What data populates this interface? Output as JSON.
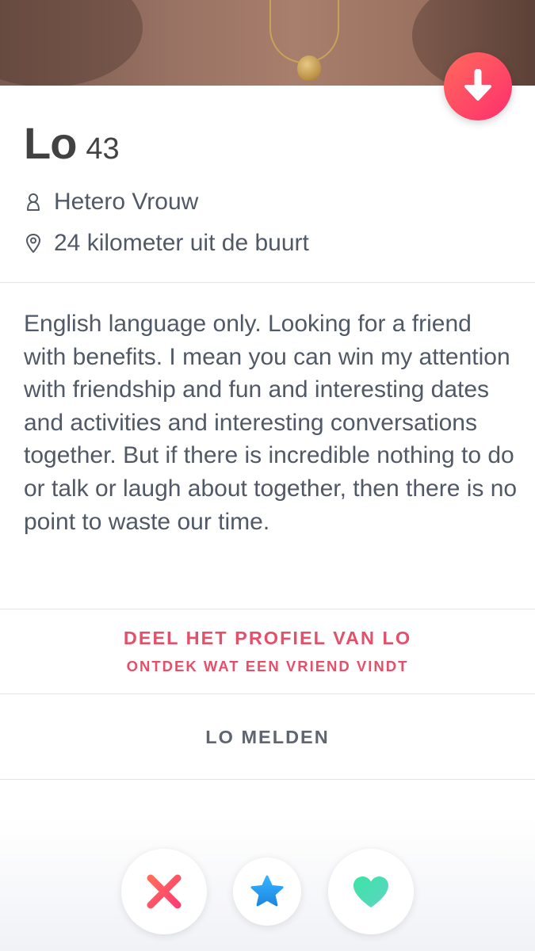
{
  "profile": {
    "name": "Lo",
    "age": "43",
    "orientation": "Hetero Vrouw",
    "distance": "24 kilometer uit de buurt",
    "bio": "English language only. Looking for a friend with benefits. I mean you can win my attention with friendship and fun and interesting dates and activities and interesting conversations together. But if there is incredible nothing to do or talk or laugh about together, then there is no point to waste our time."
  },
  "share": {
    "title": "DEEL HET PROFIEL VAN LO",
    "subtitle": "ONTDEK WAT EEN VRIEND VINDT"
  },
  "report": {
    "label": "LO MELDEN"
  },
  "icons": {
    "collapse": "arrow-down-icon",
    "orientation": "person-icon",
    "location": "location-pin-icon",
    "nope": "x-icon",
    "super_like": "star-icon",
    "like": "heart-icon"
  },
  "colors": {
    "accent": "#fd2f6e",
    "share_text": "#e4506a",
    "super_like": "#2a9bef",
    "like": "#47dba5"
  }
}
